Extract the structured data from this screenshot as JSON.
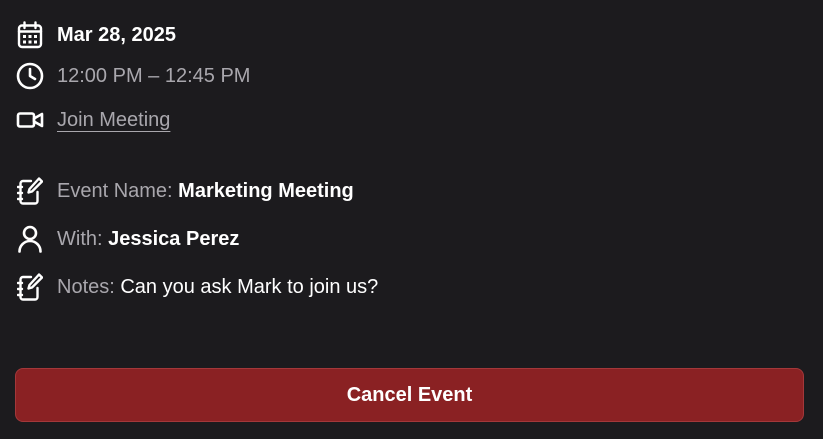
{
  "event": {
    "date": "Mar 28, 2025",
    "time": "12:00 PM – 12:45 PM",
    "join_link": "Join Meeting",
    "name_label": "Event Name: ",
    "name_value": "Marketing Meeting",
    "with_label": "With: ",
    "with_value": "Jessica Perez",
    "notes_label": "Notes: ",
    "notes_value": "Can you ask Mark to join us?"
  },
  "actions": {
    "cancel_label": "Cancel Event"
  },
  "colors": {
    "background": "#1c1b1e",
    "muted_text": "#a9a7ad",
    "cancel_button": "#8a2123"
  },
  "icons": {
    "date": "calendar-icon",
    "time": "clock-icon",
    "meeting": "video-camera-icon",
    "event_name": "notebook-edit-icon",
    "with": "person-icon",
    "notes": "notebook-edit-icon"
  }
}
